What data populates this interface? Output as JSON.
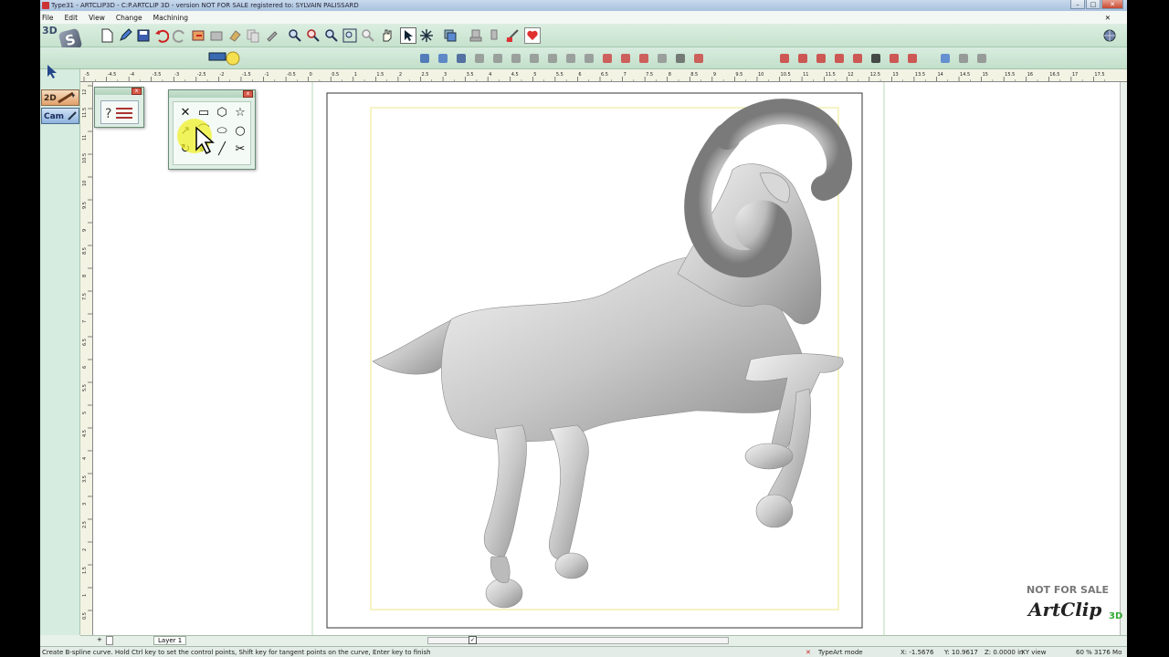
{
  "window": {
    "title": "Type31 - ARTCLIP3D - C:P.ARTCLIP 3D - version NOT FOR SALE registered to: SYLVAIN PALISSARD",
    "buttons": [
      "–",
      "□",
      "✕"
    ]
  },
  "menu": {
    "items": [
      "File",
      "Edit",
      "View",
      "Change",
      "Machining"
    ],
    "close": "✕"
  },
  "logo": {
    "label": "3D",
    "glyph": "S"
  },
  "left_panel": {
    "tab_2d": "2D",
    "tab_cam": "Cam"
  },
  "ruler_top_labels": [
    "-5",
    "-4.5",
    "-4",
    "-3.5",
    "-3",
    "-2.5",
    "-2",
    "-1.5",
    "-1",
    "-0.5",
    "0",
    "0.5",
    "1",
    "1.5",
    "2",
    "2.5",
    "3",
    "3.5",
    "4",
    "4.5",
    "5",
    "5.5",
    "6",
    "6.5",
    "7",
    "7.5",
    "8",
    "8.5",
    "9",
    "9.5",
    "10",
    "10.5",
    "11",
    "11.5",
    "12",
    "12.5",
    "13",
    "13.5",
    "14",
    "14.5",
    "15",
    "15.5",
    "16",
    "16.5",
    "17",
    "17.5"
  ],
  "ruler_left_labels": [
    "12",
    "11.5",
    "11",
    "10.5",
    "10",
    "9.5",
    "9",
    "8.5",
    "8",
    "7.5",
    "7",
    "6.5",
    "6",
    "5.5",
    "5",
    "4.5",
    "4",
    "3.5",
    "3",
    "2.5",
    "2",
    "1.5",
    "1",
    "0.5"
  ],
  "shape_palette": {
    "tools": [
      {
        "name": "cross-tool",
        "glyph": "✕"
      },
      {
        "name": "rounded-rect-tool",
        "glyph": "▭"
      },
      {
        "name": "hexagon-tool",
        "glyph": "⬡"
      },
      {
        "name": "star-tool",
        "glyph": "☆"
      },
      {
        "name": "arrow-tool",
        "glyph": "↗"
      },
      {
        "name": "bspline-tool",
        "glyph": "⌒"
      },
      {
        "name": "ellipse-tool",
        "glyph": "⬭"
      },
      {
        "name": "circle-tool",
        "glyph": "○"
      },
      {
        "name": "rotate-tool",
        "glyph": "↻"
      },
      {
        "name": "pen-tool",
        "glyph": "✐"
      },
      {
        "name": "line-tool",
        "glyph": "╱"
      },
      {
        "name": "scissors-tool",
        "glyph": "✂"
      }
    ]
  },
  "layers": {
    "layer_name": "Layer 1",
    "plus": "+",
    "close": "✕"
  },
  "status": {
    "hint": "Create B-spline curve. Hold Ctrl key to set the control points, Shift key for tangent points on the curve, Enter key to finish",
    "mode": "TypeArt mode",
    "x": "X: -1.5676",
    "y": "Y: 10.9617",
    "z": "Z: 0.0000 in",
    "view": "XY view",
    "zoom": "60 % 3176 Mo"
  },
  "watermark": {
    "line1": "NOT FOR SALE",
    "brand": "ArtClip",
    "suffix": "3D"
  }
}
